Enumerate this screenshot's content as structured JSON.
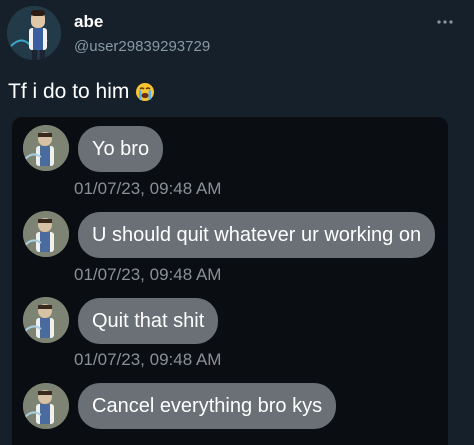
{
  "post": {
    "display_name": "abe",
    "handle": "@user29839293729",
    "text": "Tf i do to him",
    "text_emoji_icon": "loudly-crying-face-emoji",
    "more_icon": "more-horizontal-icon"
  },
  "embed": {
    "messages": [
      {
        "text": "Yo bro",
        "timestamp": "01/07/23, 09:48 AM"
      },
      {
        "text": "U should quit whatever ur working on",
        "timestamp": "01/07/23, 09:48 AM"
      },
      {
        "text": "Quit that shit",
        "timestamp": "01/07/23, 09:48 AM"
      },
      {
        "text": "Cancel everything bro kys"
      }
    ]
  },
  "colors": {
    "background": "#15202b",
    "embed_background": "#0a0d11",
    "bubble": "#6a7075",
    "secondary_text": "#8899a6"
  }
}
